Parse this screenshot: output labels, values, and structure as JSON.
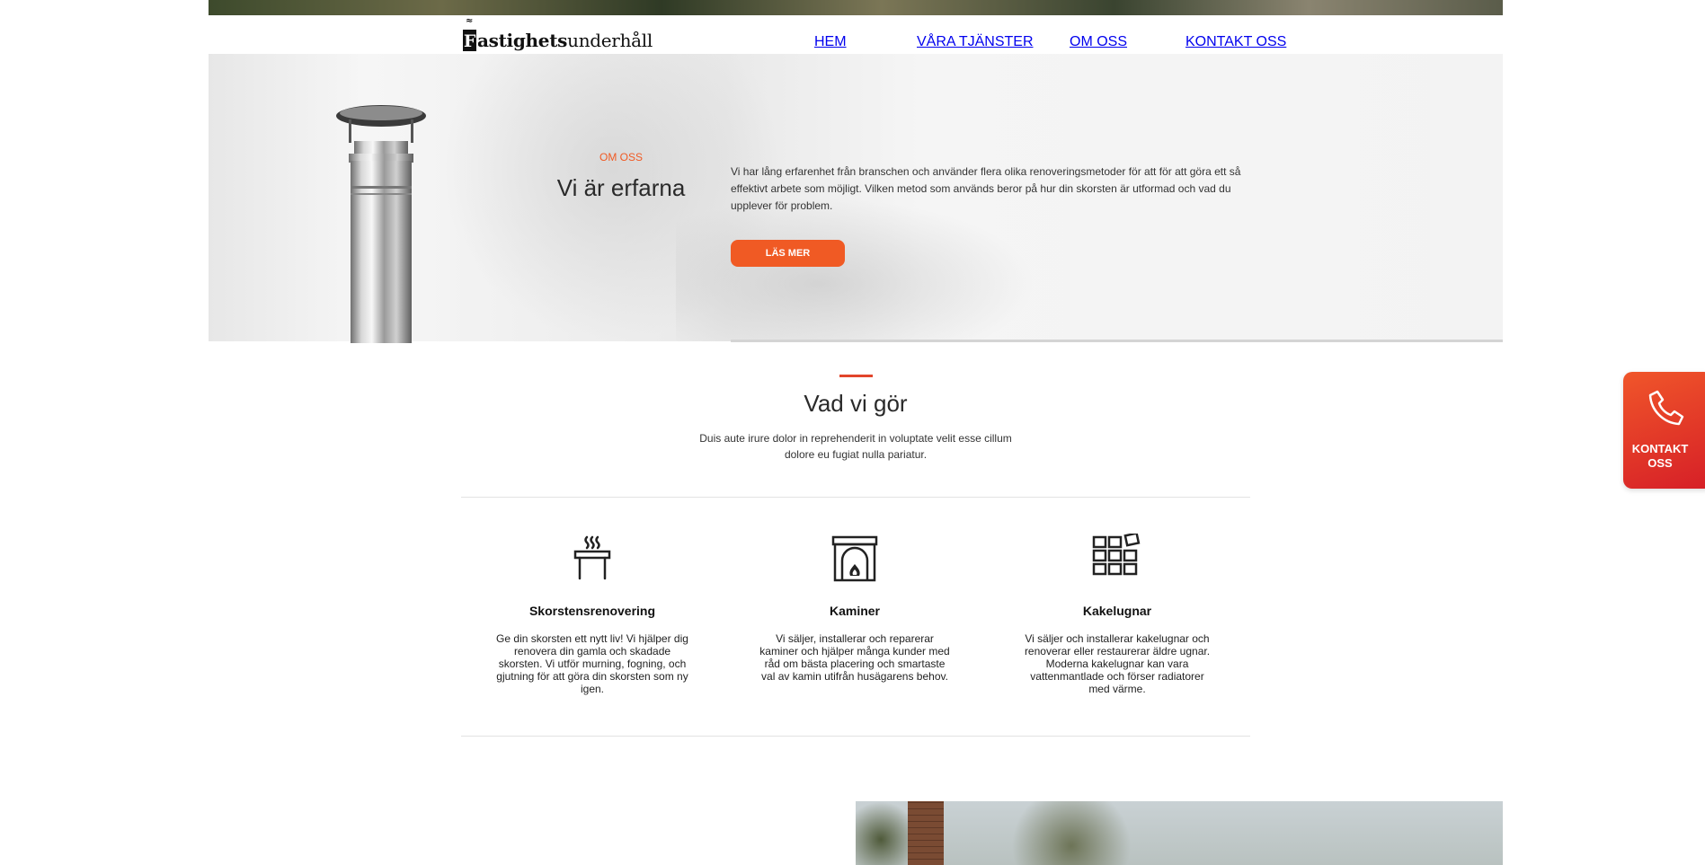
{
  "brand": {
    "logo_initial": "F",
    "logo_bold": "astighets",
    "logo_regular": "underhåll"
  },
  "nav": {
    "items": [
      {
        "label": "HEM"
      },
      {
        "label": "VÅRA TJÄNSTER"
      },
      {
        "label": "OM OSS"
      },
      {
        "label": "KONTAKT OSS"
      }
    ]
  },
  "about": {
    "eyebrow": "OM OSS",
    "title": "Vi är erfarna",
    "text": "Vi har lång erfarenhet från branschen och använder flera olika renoveringsmetoder för att för att göra ett så effektivt arbete som möjligt. Vilken metod som används beror på hur din skorsten är utformad och vad du upplever för problem.",
    "button": "LÄS MER"
  },
  "services": {
    "title": "Vad vi gör",
    "subtitle": "Duis aute irure dolor in reprehenderit in voluptate velit esse cillum dolore eu fugiat nulla pariatur.",
    "items": [
      {
        "icon": "chimney-icon",
        "title": "Skorstensrenovering",
        "text": "Ge din skorsten ett nytt liv! Vi hjälper dig renovera din gamla och skadade skorsten. Vi utför murning, fogning, och gjutning för att göra din skorsten som ny igen."
      },
      {
        "icon": "fireplace-icon",
        "title": "Kaminer",
        "text": "Vi säljer, installerar och reparerar kaminer och hjälper många kunder med råd om bästa placering och smartaste val av kamin utifrån husägarens behov."
      },
      {
        "icon": "tiles-icon",
        "title": "Kakelugnar",
        "text": "Vi säljer och installerar kakelugnar och renoverar eller restaurerar äldre ugnar. Moderna kakelugnar kan vara vattenmantlade och förser radiatorer med värme."
      }
    ]
  },
  "floating_contact": {
    "label": "KONTAKT OSS",
    "icon": "phone-icon"
  },
  "colors": {
    "accent": "#f05a24",
    "accent_dark": "#d61f27"
  }
}
